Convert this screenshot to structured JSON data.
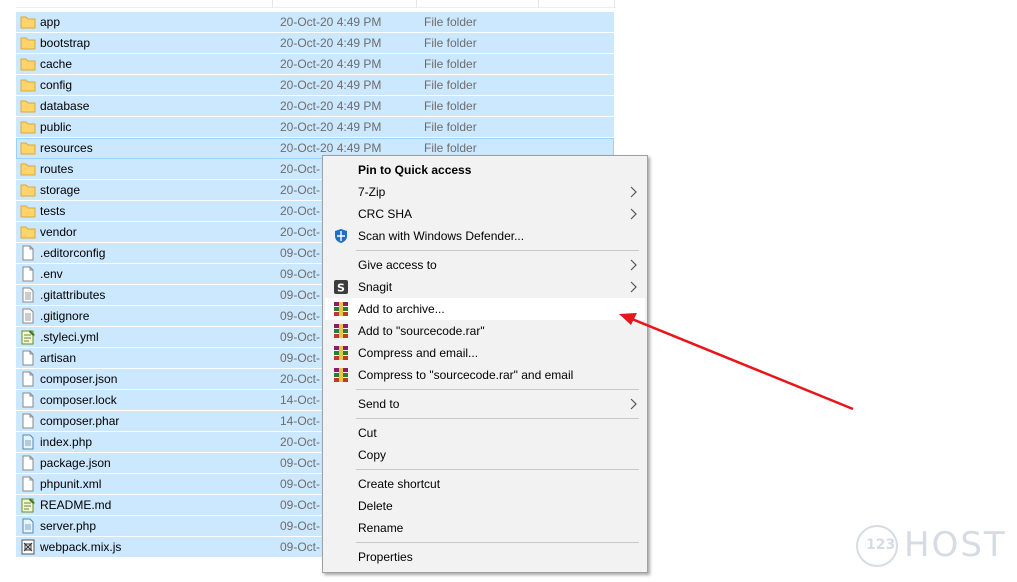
{
  "files": [
    {
      "name": "app",
      "date": "20-Oct-20 4:49 PM",
      "type": "File folder",
      "icon": "folder-icon"
    },
    {
      "name": "bootstrap",
      "date": "20-Oct-20 4:49 PM",
      "type": "File folder",
      "icon": "folder-icon"
    },
    {
      "name": "cache",
      "date": "20-Oct-20 4:49 PM",
      "type": "File folder",
      "icon": "folder-icon"
    },
    {
      "name": "config",
      "date": "20-Oct-20 4:49 PM",
      "type": "File folder",
      "icon": "folder-icon"
    },
    {
      "name": "database",
      "date": "20-Oct-20 4:49 PM",
      "type": "File folder",
      "icon": "folder-icon"
    },
    {
      "name": "public",
      "date": "20-Oct-20 4:49 PM",
      "type": "File folder",
      "icon": "folder-icon"
    },
    {
      "name": "resources",
      "date": "20-Oct-20 4:49 PM",
      "type": "File folder",
      "icon": "folder-icon"
    },
    {
      "name": "routes",
      "date": "20-Oct-",
      "type": "",
      "icon": "folder-icon"
    },
    {
      "name": "storage",
      "date": "20-Oct-",
      "type": "",
      "icon": "folder-icon"
    },
    {
      "name": "tests",
      "date": "20-Oct-",
      "type": "",
      "icon": "folder-icon"
    },
    {
      "name": "vendor",
      "date": "20-Oct-",
      "type": "",
      "icon": "folder-icon"
    },
    {
      "name": ".editorconfig",
      "date": "09-Oct-",
      "type": "",
      "icon": "file-icon"
    },
    {
      "name": ".env",
      "date": "09-Oct-",
      "type": "",
      "icon": "file-icon"
    },
    {
      "name": ".gitattributes",
      "date": "09-Oct-",
      "type": "",
      "icon": "text-file-icon"
    },
    {
      "name": ".gitignore",
      "date": "09-Oct-",
      "type": "",
      "icon": "text-file-icon"
    },
    {
      "name": ".styleci.yml",
      "date": "09-Oct-",
      "type": "",
      "icon": "notepad-file-icon"
    },
    {
      "name": "artisan",
      "date": "09-Oct-",
      "type": "",
      "icon": "file-icon"
    },
    {
      "name": "composer.json",
      "date": "20-Oct-",
      "type": "",
      "icon": "file-icon"
    },
    {
      "name": "composer.lock",
      "date": "14-Oct-",
      "type": "",
      "icon": "file-icon"
    },
    {
      "name": "composer.phar",
      "date": "14-Oct-",
      "type": "",
      "icon": "file-icon"
    },
    {
      "name": "index.php",
      "date": "20-Oct-",
      "type": "",
      "icon": "php-file-icon"
    },
    {
      "name": "package.json",
      "date": "09-Oct-",
      "type": "",
      "icon": "file-icon"
    },
    {
      "name": "phpunit.xml",
      "date": "09-Oct-",
      "type": "",
      "icon": "file-icon"
    },
    {
      "name": "README.md",
      "date": "09-Oct-",
      "type": "",
      "icon": "notepad-file-icon"
    },
    {
      "name": "server.php",
      "date": "09-Oct-",
      "type": "",
      "icon": "php-file-icon"
    },
    {
      "name": "webpack.mix.js",
      "date": "09-Oct-",
      "type": "",
      "icon": "js-file-icon"
    }
  ],
  "context_menu": {
    "items": [
      {
        "label": "Pin to Quick access",
        "bold": true
      },
      {
        "label": "7-Zip",
        "submenu": true
      },
      {
        "label": "CRC SHA",
        "submenu": true
      },
      {
        "label": "Scan with Windows Defender...",
        "icon": "defender-shield-icon"
      },
      {
        "label": "Give access to",
        "submenu": true
      },
      {
        "label": "Snagit",
        "submenu": true,
        "icon": "snagit-icon"
      },
      {
        "label": "Add to archive...",
        "icon": "winrar-icon",
        "hovered": true
      },
      {
        "label": "Add to \"sourcecode.rar\"",
        "icon": "winrar-icon"
      },
      {
        "label": "Compress and email...",
        "icon": "winrar-icon"
      },
      {
        "label": "Compress to \"sourcecode.rar\" and email",
        "icon": "winrar-icon"
      },
      {
        "label": "Send to",
        "submenu": true
      },
      {
        "label": "Cut"
      },
      {
        "label": "Copy"
      },
      {
        "label": "Create shortcut"
      },
      {
        "label": "Delete"
      },
      {
        "label": "Rename"
      },
      {
        "label": "Properties"
      }
    ]
  },
  "watermark": {
    "number": "123",
    "text": "HOST"
  },
  "colors": {
    "selection": "#cce8ff",
    "menu_bg": "#f2f2f2",
    "arrow": "#e8161b",
    "folder": "#ffd56b"
  }
}
